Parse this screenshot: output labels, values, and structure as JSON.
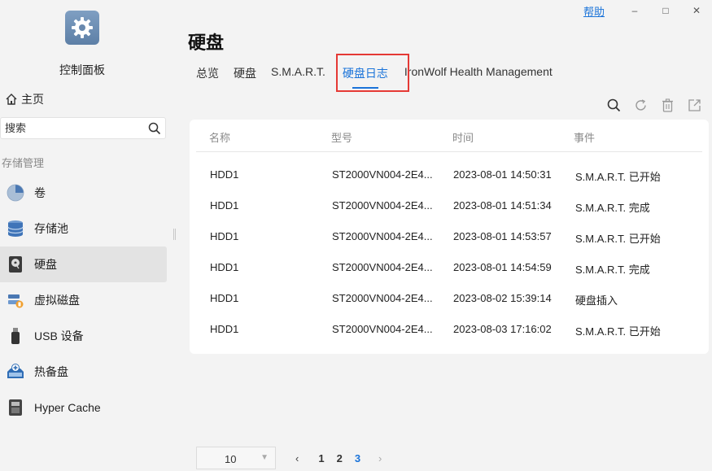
{
  "window": {
    "help_label": "帮助",
    "minimize_glyph": "–",
    "maximize_glyph": "□",
    "close_glyph": "✕"
  },
  "sidebar": {
    "app_title": "控制面板",
    "home_label": "主页",
    "search_placeholder": "搜索",
    "section_label": "存储管理",
    "items": [
      {
        "label": "卷",
        "icon": "volume-pie-icon"
      },
      {
        "label": "存储池",
        "icon": "storage-pool-icon"
      },
      {
        "label": "硬盘",
        "icon": "hard-disk-icon",
        "active": true
      },
      {
        "label": "虚拟磁盘",
        "icon": "virtual-disk-icon"
      },
      {
        "label": "USB 设备",
        "icon": "usb-icon"
      },
      {
        "label": "热备盘",
        "icon": "hot-spare-icon"
      },
      {
        "label": "Hyper Cache",
        "icon": "hyper-cache-icon"
      }
    ]
  },
  "main": {
    "title": "硬盘",
    "tabs": [
      {
        "label": "总览"
      },
      {
        "label": "硬盘"
      },
      {
        "label": "S.M.A.R.T."
      },
      {
        "label": "硬盘日志",
        "active": true
      },
      {
        "label": "IronWolf Health Management"
      }
    ],
    "toolbar": [
      "search-icon",
      "refresh-icon",
      "delete-icon",
      "export-icon"
    ],
    "table": {
      "headers": [
        "名称",
        "型号",
        "时间",
        "事件"
      ],
      "rows": [
        [
          "HDD1",
          "ST2000VN004-2E4...",
          "2023-08-01 14:50:31",
          "S.M.A.R.T. 已开始"
        ],
        [
          "HDD1",
          "ST2000VN004-2E4...",
          "2023-08-01 14:51:34",
          "S.M.A.R.T. 完成"
        ],
        [
          "HDD1",
          "ST2000VN004-2E4...",
          "2023-08-01 14:53:57",
          "S.M.A.R.T. 已开始"
        ],
        [
          "HDD1",
          "ST2000VN004-2E4...",
          "2023-08-01 14:54:59",
          "S.M.A.R.T. 完成"
        ],
        [
          "HDD1",
          "ST2000VN004-2E4...",
          "2023-08-02 15:39:14",
          "硬盘插入"
        ],
        [
          "HDD1",
          "ST2000VN004-2E4...",
          "2023-08-03 17:16:02",
          "S.M.A.R.T. 已开始"
        ]
      ]
    },
    "pagination": {
      "page_size": "10",
      "prev_glyph": "‹",
      "next_glyph": "›",
      "pages": [
        "1",
        "2",
        "3"
      ],
      "current_page": "3"
    }
  },
  "colors": {
    "accent": "#1a73d9",
    "highlight_box": "#e53935",
    "background": "#f3f3f3",
    "active_nav": "#e3e3e3"
  }
}
